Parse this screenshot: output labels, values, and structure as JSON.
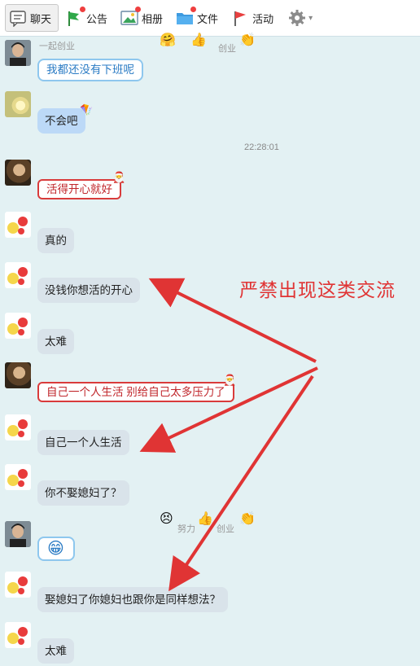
{
  "toolbar": {
    "tabs": [
      {
        "label": "聊天",
        "icon": "chat-icon",
        "active": true
      },
      {
        "label": "公告",
        "icon": "flag-icon"
      },
      {
        "label": "相册",
        "icon": "album-icon"
      },
      {
        "label": "文件",
        "icon": "folder-icon"
      },
      {
        "label": "活动",
        "icon": "event-flag-icon"
      }
    ],
    "settings_icon": "gear-icon",
    "caret": "▾"
  },
  "messages": [
    {
      "sender_nick": "一起创业",
      "badge_text": "创业",
      "text": "我都还没有下班呢",
      "avatar": "man"
    },
    {
      "text": "不会吧",
      "avatar": "flower"
    },
    {
      "time": "22:28:01"
    },
    {
      "text": "活得开心就好",
      "avatar": "girl"
    },
    {
      "text": "真的",
      "avatar": "cartoon"
    },
    {
      "text": "没钱你想活的开心",
      "avatar": "cartoon"
    },
    {
      "text": "太难",
      "avatar": "cartoon"
    },
    {
      "text": "自己一个人生活 别给自己太多压力了",
      "avatar": "girl"
    },
    {
      "text": "自己一个人生活",
      "avatar": "cartoon"
    },
    {
      "text": "你不娶媳妇了？",
      "avatar": "cartoon"
    },
    {
      "badge_text": "努力",
      "badge_text2": "创业",
      "text": "😁",
      "avatar": "man"
    },
    {
      "text": "娶媳妇了你媳妇也跟你是同样想法？",
      "avatar": "cartoon"
    },
    {
      "text": "太难",
      "avatar": "cartoon"
    }
  ],
  "overlay": {
    "warning_text": "严禁出现这类交流",
    "color": "#e03434"
  },
  "colors": {
    "background": "#e3f1f3",
    "bubble_gray": "#d9e3ea",
    "bubble_blue": "#bcd9f7",
    "frame_red": "#d93b3b",
    "frame_blue": "#8ec7ee"
  }
}
